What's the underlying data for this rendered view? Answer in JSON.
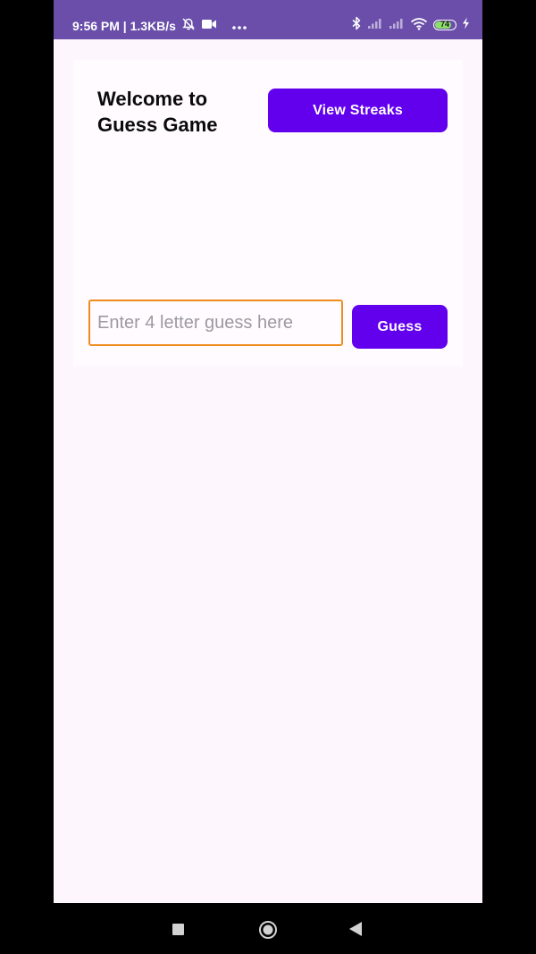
{
  "status_bar": {
    "time_speed": "9:56 PM | 1.3KB/s",
    "battery_level": "74",
    "background": "#6a4eaa",
    "icons": [
      "alarm-off-icon",
      "video-icon",
      "more-icon",
      "bluetooth-icon",
      "signal-icon",
      "signal-icon",
      "wifi-icon",
      "battery-icon",
      "charging-icon"
    ]
  },
  "main": {
    "title": "Welcome to Guess Game",
    "view_streaks_label": "View Streaks",
    "guess_input": {
      "placeholder": "Enter 4 letter guess here",
      "value": ""
    },
    "guess_button_label": "Guess"
  },
  "nav_bar": {
    "icons": [
      "recents-icon",
      "home-icon",
      "back-icon"
    ]
  },
  "colors": {
    "accent": "#6200ee",
    "input_focus_border": "#f08c1e",
    "background": "#fdf7fd"
  }
}
